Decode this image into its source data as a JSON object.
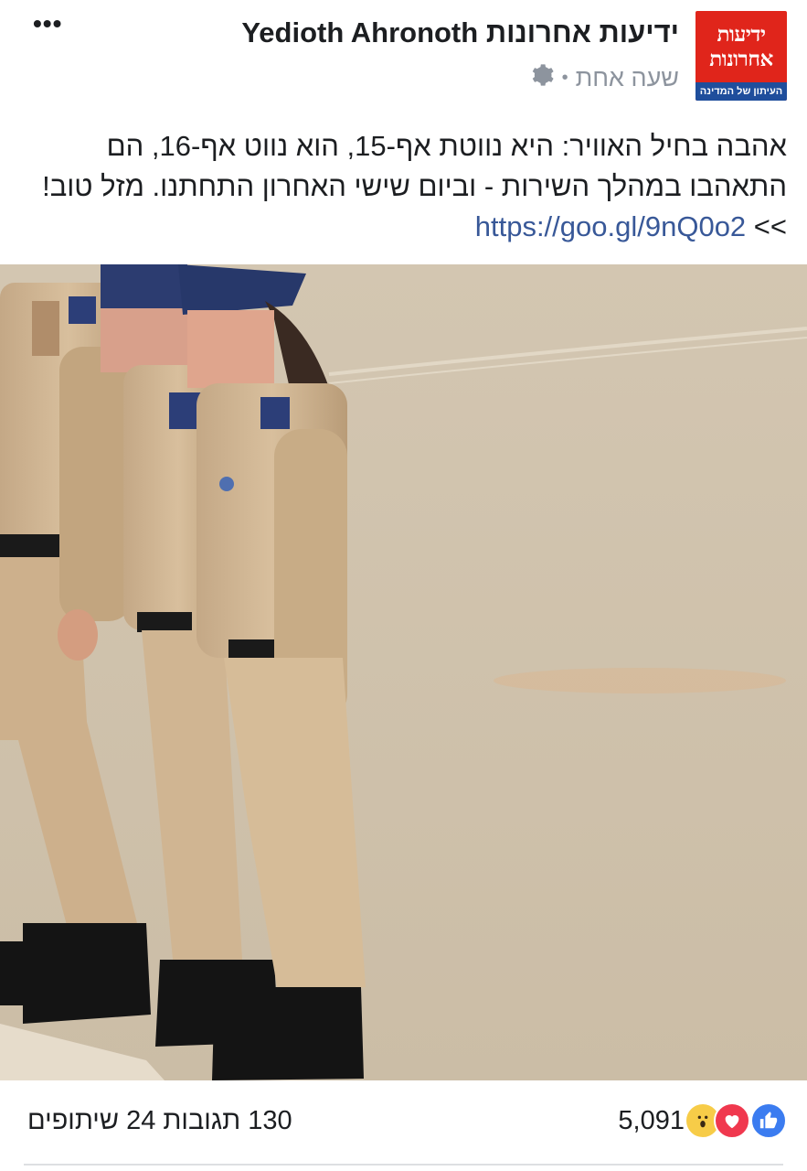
{
  "page": {
    "name": "ידיעות אחרונות Yedioth Ahronoth",
    "logo_line1": "ידיעות",
    "logo_line2": "אחרונות",
    "logo_tagline": "העיתון של המדינה",
    "time": "שעה אחת",
    "separator": "•",
    "more_label": "•••",
    "privacy_icon": "gear-icon"
  },
  "post": {
    "text": "אהבה בחיל האוויר: היא נווטת אף-15, הוא נווט אף-16, הם התאהבו במהלך השירות - וביום שישי האחרון התחתנו. מזל טוב! >> ",
    "link": "https://goo.gl/9nQ0o2"
  },
  "footer": {
    "reaction_count": "5,091",
    "stats": "130 תגובות 24 שיתופים",
    "reaction_icons": [
      "like-icon",
      "love-icon",
      "wow-icon"
    ]
  },
  "colors": {
    "logo_red": "#e0251b",
    "logo_blue": "#1f4e9c",
    "link": "#385898",
    "like": "#3b7cf0",
    "love": "#f0384e",
    "wow": "#f7cc48"
  }
}
